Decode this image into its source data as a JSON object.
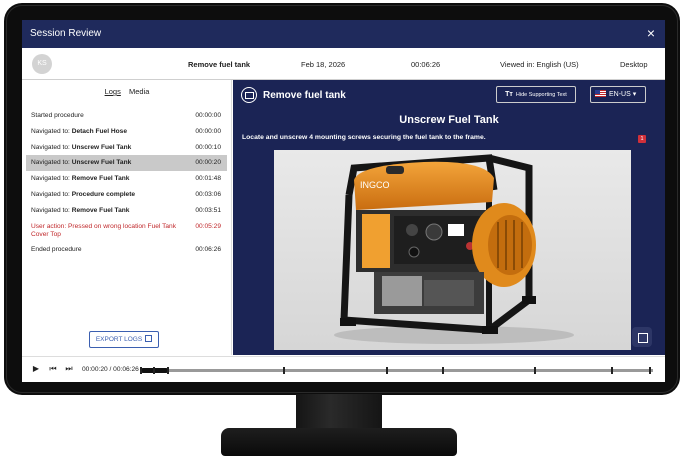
{
  "window": {
    "title": "Session Review",
    "close_label": "×"
  },
  "session": {
    "avatar_initials": "KS",
    "procedure": "Remove fuel tank",
    "date": "Feb 18, 2026",
    "duration": "00:06:26",
    "viewed_in": "Viewed in: English (US)",
    "device": "Desktop"
  },
  "left_panel": {
    "tabs": [
      {
        "label": "Logs",
        "active": true
      },
      {
        "label": "Media",
        "active": false
      }
    ],
    "logs": [
      {
        "prefix": "Started procedure",
        "target": "",
        "time": "00:00:00"
      },
      {
        "prefix": "Navigated to: ",
        "target": "Detach Fuel Hose",
        "time": "00:00:00"
      },
      {
        "prefix": "Navigated to: ",
        "target": "Unscrew Fuel Tank",
        "time": "00:00:10"
      },
      {
        "prefix": "Navigated to: ",
        "target": "Unscrew Fuel Tank",
        "time": "00:00:20",
        "selected": true
      },
      {
        "prefix": "Navigated to: ",
        "target": "Remove Fuel Tank",
        "time": "00:01:48"
      },
      {
        "prefix": "Navigated to: ",
        "target": "Procedure complete",
        "time": "00:03:06"
      },
      {
        "prefix": "Navigated to: ",
        "target": "Remove Fuel Tank",
        "time": "00:03:51"
      },
      {
        "prefix": "User action: Pressed on wrong location Fuel Tank Cover Top",
        "target": "",
        "time": "00:05:29",
        "error": true
      },
      {
        "prefix": "Ended procedure",
        "target": "",
        "time": "00:06:26"
      }
    ],
    "export_label": "EXPORT LOGS"
  },
  "right_panel": {
    "header_title": "Remove fuel tank",
    "hide_button": {
      "icon": "Tт",
      "label": "Hide Supporting Text"
    },
    "language": {
      "label": "EN-US",
      "flag": "us-flag-icon"
    },
    "step_title": "Unscrew Fuel Tank",
    "step_description": "Locate and unscrew 4 mounting screws securing the fuel tank to the frame.",
    "badge": "1",
    "image": {
      "brand": "INGCO",
      "subject": "portable generator",
      "accent": "#e58a1f"
    }
  },
  "timeline": {
    "time_display": "00:00:20 / 00:06:26",
    "progress": 0.052,
    "markers": [
      0.0,
      0.026,
      0.052,
      0.28,
      0.48,
      0.59,
      0.77,
      0.92,
      0.995
    ]
  },
  "colors": {
    "titlebar": "#1f2a5c",
    "panel": "#1b2455",
    "error": "#c0282b",
    "accent": "#3b5fb0"
  }
}
